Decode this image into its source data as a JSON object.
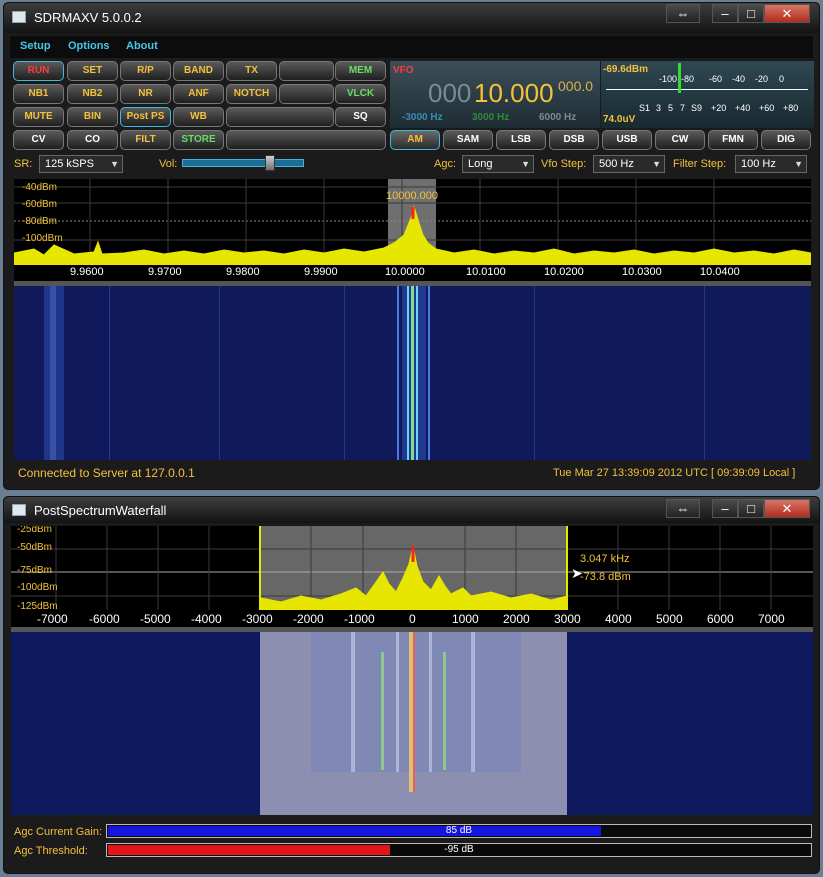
{
  "main_window": {
    "title": "SDRMAXV 5.0.0.2",
    "menu": [
      "Setup",
      "Options",
      "About"
    ],
    "buttons": {
      "row1": [
        "RUN",
        "SET",
        "R/P",
        "BAND",
        "TX",
        "",
        "MEM"
      ],
      "row2": [
        "NB1",
        "NB2",
        "NR",
        "ANF",
        "NOTCH",
        "",
        "VLCK"
      ],
      "row3": [
        "MUTE",
        "BIN",
        "Post PS",
        "WB",
        "",
        "SQ"
      ],
      "row4": [
        "CV",
        "CO",
        "FILT",
        "STORE",
        ""
      ]
    },
    "vfo": {
      "label": "VFO",
      "freq_dim": "000",
      "freq_main": "10.000",
      "freq_sub": "000.0",
      "filter_low": "-3000 Hz",
      "filter_center": "3000 Hz",
      "filter_high": "6000 Hz"
    },
    "meter": {
      "dbm": "-69.6dBm",
      "uv": "74.0uV",
      "top_scale": [
        "-100",
        "-80",
        "-60",
        "-40",
        "-20",
        "0"
      ],
      "bottom_scale": [
        "S1",
        "3",
        "5",
        "7",
        "S9",
        "+20",
        "+40",
        "+60",
        "+80"
      ],
      "level_fraction": 0.36
    },
    "modes": [
      "AM",
      "SAM",
      "LSB",
      "DSB",
      "USB",
      "CW",
      "FMN",
      "DIG"
    ],
    "selected_mode": "AM",
    "controls": {
      "sr_label": "SR:",
      "sr_value": "125 kSPS",
      "vol_label": "Vol:",
      "vol_level": 0.73,
      "agc_label": "Agc:",
      "agc_value": "Long",
      "vfo_step_label": "Vfo Step:",
      "vfo_step_value": "500 Hz",
      "filter_step_label": "Filter Step:",
      "filter_step_value": "100 Hz"
    },
    "spectrum": {
      "y_labels": [
        "-40dBm",
        "-60dBm",
        "-80dBm",
        "-100dBm"
      ],
      "x_labels": [
        "9.9600",
        "9.9700",
        "9.9800",
        "9.9900",
        "10.0000",
        "10.0100",
        "10.0200",
        "10.0300",
        "10.0400"
      ],
      "marker_label": "10000.000"
    },
    "status_left": "Connected to Server at 127.0.0.1",
    "status_right": "Tue Mar 27 13:39:09 2012 UTC [ 09:39:09 Local ]"
  },
  "post_window": {
    "title": "PostSpectrumWaterfall",
    "y_labels": [
      "-25dBm",
      "-50dBm",
      "-75dBm",
      "-100dBm",
      "-125dBm"
    ],
    "x_labels": [
      "-7000",
      "-6000",
      "-5000",
      "-4000",
      "-3000",
      "-2000",
      "-1000",
      "0",
      "1000",
      "2000",
      "3000",
      "4000",
      "5000",
      "6000",
      "7000"
    ],
    "cursor_freq": "3.047  kHz",
    "cursor_level": "-73.8 dBm",
    "agc_gain_label": "Agc Current Gain:",
    "agc_gain_value": "85 dB",
    "agc_gain_fraction": 0.7,
    "agc_threshold_label": "Agc Threshold:",
    "agc_threshold_value": "-95 dB",
    "agc_threshold_fraction": 0.4
  },
  "colors": {
    "accent_text": "#f4c13b",
    "menu_text": "#44c7e5",
    "trace": "#e6e600",
    "waterfall_bg": "#101a5a",
    "gain_bar": "#1515e0",
    "threshold_bar": "#e01515"
  }
}
